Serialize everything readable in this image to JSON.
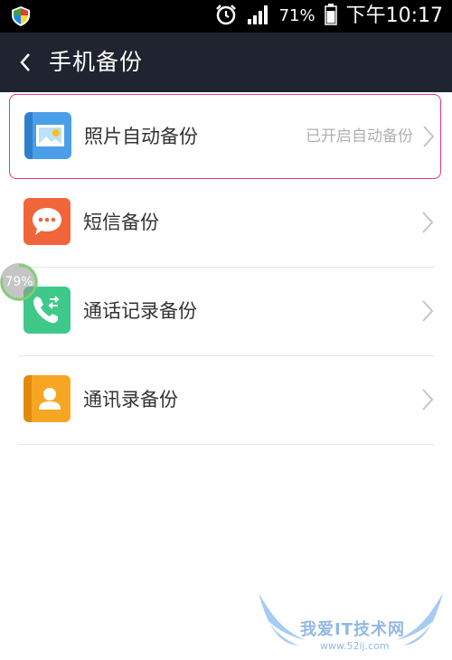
{
  "status_bar": {
    "battery": "71%",
    "time": "下午10:17"
  },
  "header": {
    "title": "手机备份"
  },
  "items": [
    {
      "label": "照片自动备份",
      "status": "已开启自动备份",
      "icon": "photo-icon",
      "color": "#4a9fe8"
    },
    {
      "label": "短信备份",
      "icon": "message-icon",
      "color": "#f0653a"
    },
    {
      "label": "通话记录备份",
      "icon": "call-log-icon",
      "color": "#3ec98a"
    },
    {
      "label": "通讯录备份",
      "icon": "contacts-icon",
      "color": "#f6a623"
    }
  ],
  "float_badge": {
    "text": "79%"
  },
  "watermark": {
    "text": "我爱IT技术网",
    "sub": "www.52ij.com"
  },
  "colors": {
    "highlight": "#e2358f",
    "app_bar": "#1f2430"
  }
}
